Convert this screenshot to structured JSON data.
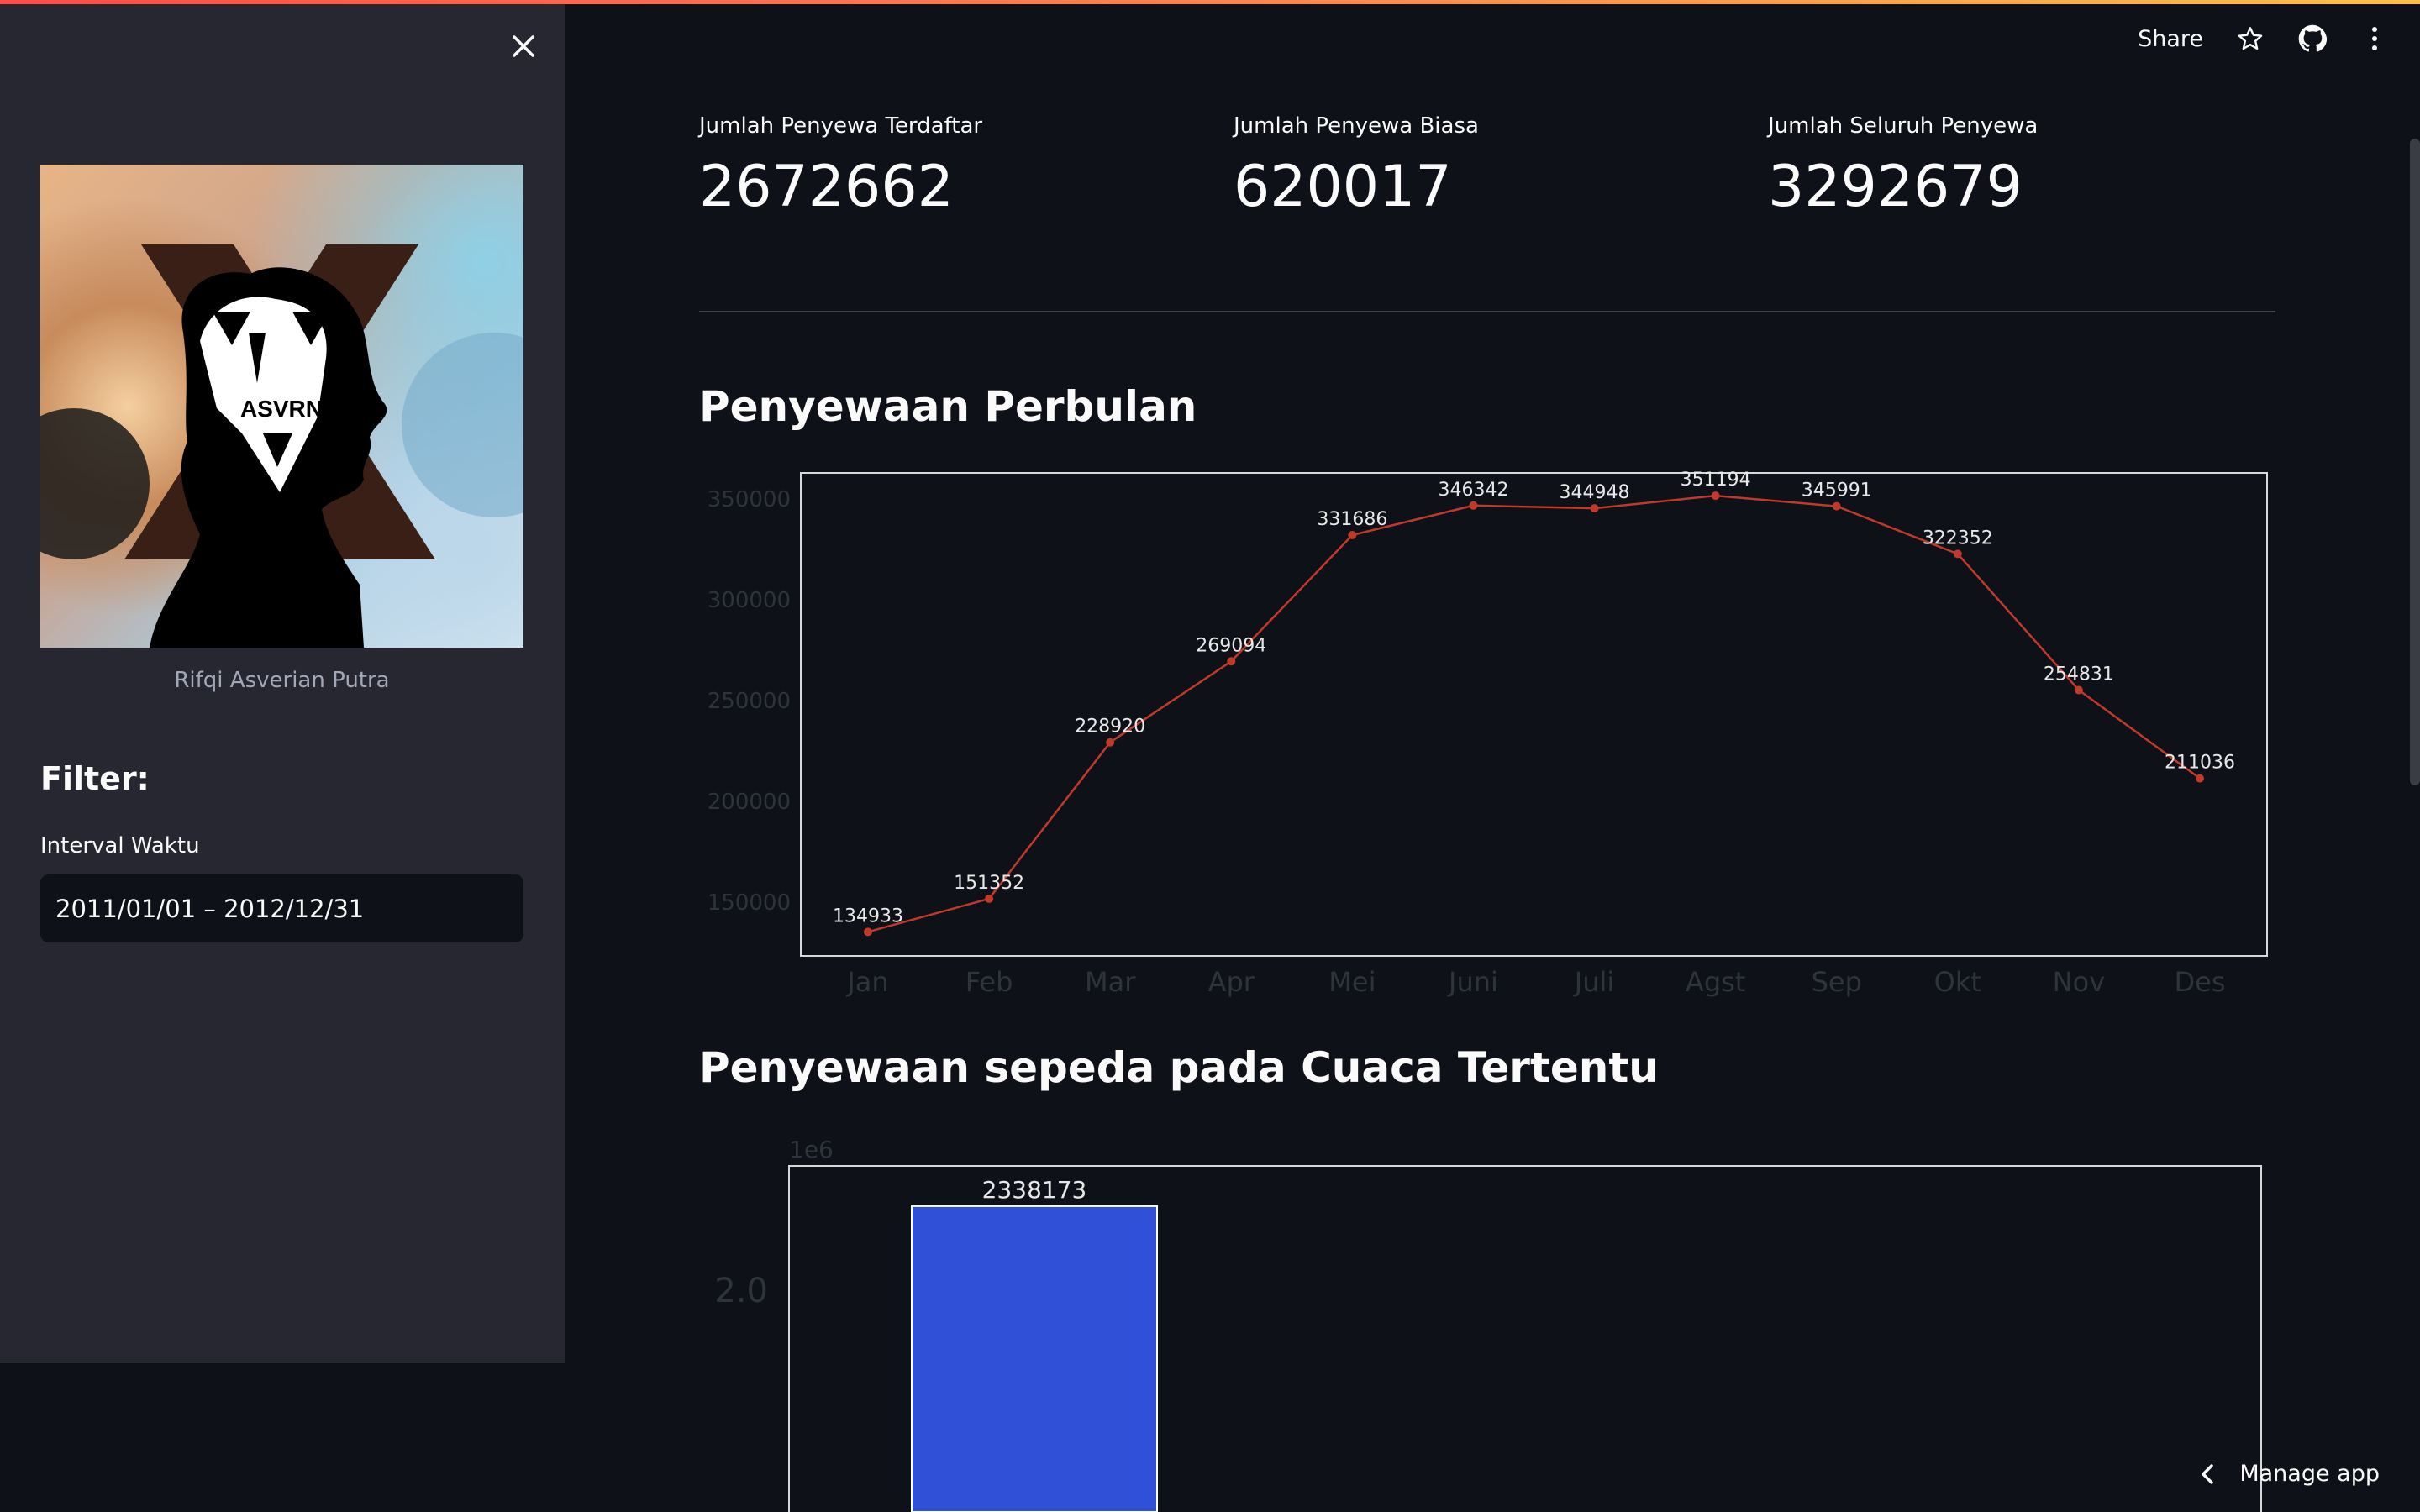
{
  "sidebar": {
    "close_icon": "close-icon",
    "avatar_logo_text": "ASVRN",
    "profile_name": "Rifqi Asverian Putra",
    "filter_title": "Filter:",
    "interval_label": "Interval Waktu",
    "interval_value": "2011/01/01 – 2012/12/31"
  },
  "header": {
    "share_label": "Share",
    "star_icon": "star-icon",
    "github_icon": "github-icon",
    "menu_icon": "more-vertical-icon"
  },
  "metrics": [
    {
      "label": "Jumlah Penyewa Terdaftar",
      "value": "2672662"
    },
    {
      "label": "Jumlah Penyewa Biasa",
      "value": "620017"
    },
    {
      "label": "Jumlah Seluruh Penyewa",
      "value": "3292679"
    }
  ],
  "sections": {
    "monthly_title": "Penyewaan Perbulan",
    "weather_title": "Penyewaan sepeda pada Cuaca Tertentu"
  },
  "chart_data": [
    {
      "type": "line",
      "categories": [
        "Jan",
        "Feb",
        "Mar",
        "Apr",
        "Mei",
        "Juni",
        "Juli",
        "Agst",
        "Sep",
        "Okt",
        "Nov",
        "Des"
      ],
      "values": [
        134933,
        151352,
        228920,
        269094,
        331686,
        346342,
        344948,
        351194,
        345991,
        322352,
        254831,
        211036
      ],
      "yticks": [
        150000,
        200000,
        250000,
        300000,
        350000
      ],
      "ylim": [
        123000,
        362500
      ],
      "grid": false,
      "color": "#c0392b"
    },
    {
      "type": "bar",
      "offset_label": "1e6",
      "values": [
        2338173
      ],
      "yticks": [
        2.0
      ],
      "ylim": [
        0,
        2.5
      ],
      "grid": false,
      "color": "#3050d8"
    }
  ],
  "footer": {
    "manage_app_label": "Manage app",
    "chevron_icon": "chevron-left-icon"
  }
}
